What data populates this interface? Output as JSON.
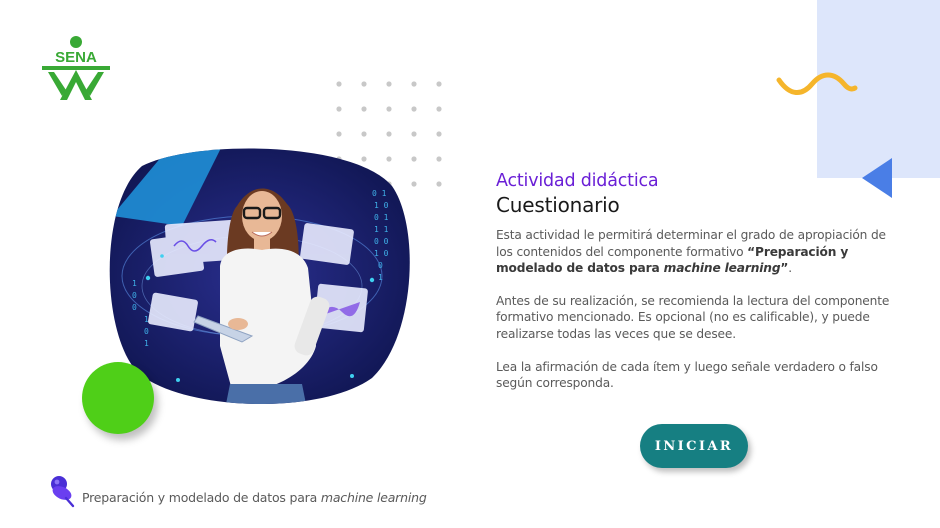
{
  "brand": {
    "logo_text": "SENA",
    "logo_color": "#39a935"
  },
  "activity": {
    "subtitle": "Actividad didáctica",
    "title": "Cuestionario",
    "para1": {
      "text1": "Esta actividad le permitirá determinar el grado de apropiación de los contenidos del componente formativo ",
      "quote_open": "“",
      "bold_text": "Preparación y modelado de datos para ",
      "bold_italic": "machine learning",
      "quote_close": "”",
      "end": "."
    },
    "para2": "Antes de su realización, se recomienda la lectura del componente formativo mencionado.  Es opcional (no es calificable), y puede realizarse todas las veces que se desee.",
    "para3": "Lea la afirmación de cada ítem y luego señale verdadero o falso según corresponda."
  },
  "actions": {
    "start_label": "INICIAR"
  },
  "footer": {
    "text": "Preparación y modelado de datos para ",
    "italic": "machine learning",
    "icon": "pushpin-icon"
  },
  "colors": {
    "accent_purple": "#6a1fd6",
    "button_teal": "#167f82",
    "green": "#4fcf18",
    "light_blue": "#dde6fb",
    "wave_yellow": "#f5b52b",
    "triangle_blue": "#4a7ee6"
  }
}
